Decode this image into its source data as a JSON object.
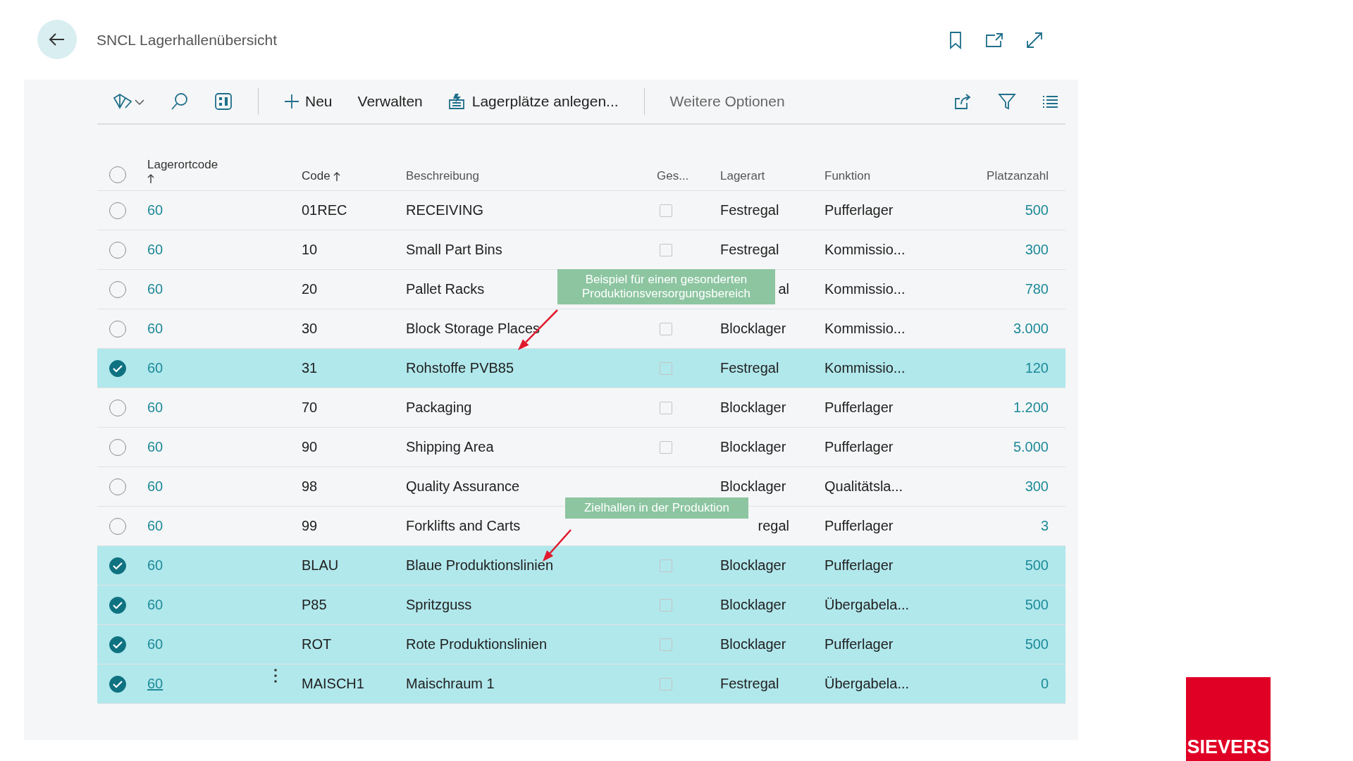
{
  "page": {
    "title": "SNCL Lagerhallenübersicht"
  },
  "toolbar": {
    "actions": [
      {
        "kind": "new",
        "label": "Neu"
      },
      {
        "kind": "plain",
        "label": "Verwalten"
      },
      {
        "kind": "create",
        "label": "Lagerplätze anlegen..."
      }
    ],
    "more": {
      "label": "Weitere Optionen"
    }
  },
  "table": {
    "all_selected": false,
    "columns": [
      {
        "label": "Lagerortcode",
        "sorted": true
      },
      {
        "label": "Code",
        "sorted": true
      },
      {
        "label": "Beschreibung",
        "sorted": false
      },
      {
        "label": "Ges...",
        "sorted": false
      },
      {
        "label": "Lagerart",
        "sorted": false
      },
      {
        "label": "Funktion",
        "sorted": false
      },
      {
        "label": "Platzanzahl",
        "sorted": false
      }
    ],
    "rows": [
      {
        "selected": false,
        "focused": false,
        "lagerortcode": "60",
        "code": "01REC",
        "beschreibung": "RECEIVING",
        "ges": false,
        "lagerart": "Festregal",
        "lagerart_covered": false,
        "funktion": "Pufferlager",
        "platzanzahl": "500"
      },
      {
        "selected": false,
        "focused": false,
        "lagerortcode": "60",
        "code": "10",
        "beschreibung": "Small Part Bins",
        "ges": false,
        "lagerart": "Festregal",
        "lagerart_covered": false,
        "funktion": "Kommissio...",
        "platzanzahl": "300"
      },
      {
        "selected": false,
        "focused": false,
        "lagerortcode": "60",
        "code": "20",
        "beschreibung": "Pallet Racks",
        "lagerart": "al",
        "lagerart_covered": true,
        "funktion": "Kommissio...",
        "platzanzahl": "780"
      },
      {
        "selected": false,
        "focused": false,
        "lagerortcode": "60",
        "code": "30",
        "beschreibung": "Block Storage Places",
        "ges": false,
        "lagerart": "Blocklager",
        "lagerart_covered": false,
        "funktion": "Kommissio...",
        "platzanzahl": "3.000"
      },
      {
        "selected": true,
        "focused": false,
        "lagerortcode": "60",
        "code": "31",
        "beschreibung": "Rohstoffe PVB85",
        "ges": false,
        "lagerart": "Festregal",
        "lagerart_covered": false,
        "funktion": "Kommissio...",
        "platzanzahl": "120"
      },
      {
        "selected": false,
        "focused": false,
        "lagerortcode": "60",
        "code": "70",
        "beschreibung": "Packaging",
        "ges": false,
        "lagerart": "Blocklager",
        "lagerart_covered": false,
        "funktion": "Pufferlager",
        "platzanzahl": "1.200"
      },
      {
        "selected": false,
        "focused": false,
        "lagerortcode": "60",
        "code": "90",
        "beschreibung": "Shipping Area",
        "ges": false,
        "lagerart": "Blocklager",
        "lagerart_covered": false,
        "funktion": "Pufferlager",
        "platzanzahl": "5.000"
      },
      {
        "selected": false,
        "focused": false,
        "lagerortcode": "60",
        "code": "98",
        "beschreibung": "Quality Assurance",
        "lagerart": "Blocklager",
        "lagerart_covered": false,
        "funktion": "Qualitätsla...",
        "platzanzahl": "300"
      },
      {
        "selected": false,
        "focused": false,
        "lagerortcode": "60",
        "code": "99",
        "beschreibung": "Forklifts and Carts",
        "lagerart": "regal",
        "lagerart_covered": true,
        "funktion": "Pufferlager",
        "platzanzahl": "3"
      },
      {
        "selected": true,
        "focused": false,
        "lagerortcode": "60",
        "code": "BLAU",
        "beschreibung": "Blaue Produktionslinien",
        "ges": false,
        "lagerart": "Blocklager",
        "lagerart_covered": false,
        "funktion": "Pufferlager",
        "platzanzahl": "500"
      },
      {
        "selected": true,
        "focused": false,
        "lagerortcode": "60",
        "code": "P85",
        "beschreibung": "Spritzguss",
        "ges": false,
        "lagerart": "Blocklager",
        "lagerart_covered": false,
        "funktion": "Übergabela...",
        "platzanzahl": "500"
      },
      {
        "selected": true,
        "focused": false,
        "lagerortcode": "60",
        "code": "ROT",
        "beschreibung": "Rote Produktionslinien",
        "ges": false,
        "lagerart": "Blocklager",
        "lagerart_covered": false,
        "funktion": "Pufferlager",
        "platzanzahl": "500"
      },
      {
        "selected": true,
        "focused": true,
        "lagerortcode": "60",
        "code": "MAISCH1",
        "beschreibung": "Maischraum 1",
        "ges": false,
        "lagerart": "Festregal",
        "lagerart_covered": false,
        "funktion": "Übergabela...",
        "platzanzahl": "0"
      }
    ]
  },
  "annotations": [
    {
      "text": "Beispiel für einen gesonderten Produktionsversorgungsbereich"
    },
    {
      "text": "Zielhallen in der Produktion"
    }
  ],
  "logo": {
    "text": "SIEVERS"
  }
}
